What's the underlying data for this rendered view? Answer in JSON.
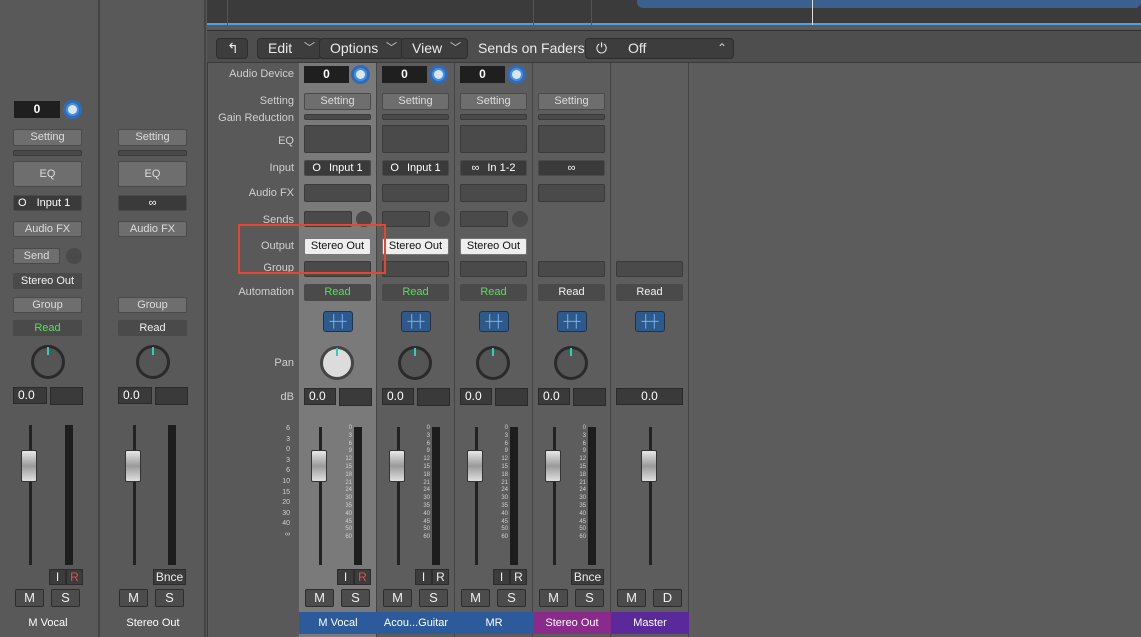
{
  "toolbar": {
    "back_icon": "↰",
    "edit": "Edit",
    "options": "Options",
    "view": "View",
    "sends_on_faders_label": "Sends on Faders:",
    "power_icon": "⏻",
    "sends_value": "Off",
    "updown_icon": "⌃"
  },
  "row_labels": {
    "audio_device": "Audio Device",
    "setting": "Setting",
    "gain_reduction": "Gain Reduction",
    "eq": "EQ",
    "input": "Input",
    "audio_fx": "Audio FX",
    "sends": "Sends",
    "output": "Output",
    "group": "Group",
    "automation": "Automation",
    "pan": "Pan",
    "db": "dB"
  },
  "inspector": {
    "left": {
      "audio_device": "0",
      "setting": "Setting",
      "eq": "EQ",
      "input": "Input 1",
      "audio_fx": "Audio FX",
      "send": "Send",
      "output": "Stereo Out",
      "group": "Group",
      "automation": "Read",
      "db": "0.0",
      "i": "I",
      "r": "R",
      "m": "M",
      "s": "S",
      "name": "M Vocal"
    },
    "right": {
      "setting": "Setting",
      "eq": "EQ",
      "input_icon": "∞",
      "audio_fx": "Audio FX",
      "group": "Group",
      "automation": "Read",
      "db": "0.0",
      "bnce": "Bnce",
      "m": "M",
      "s": "S",
      "name": "Stereo Out"
    }
  },
  "strips": [
    {
      "name": "M Vocal",
      "device": "0",
      "setting": "Setting",
      "input": "Input 1",
      "output": "Stereo Out",
      "automation": "Read",
      "db": "0.0",
      "i": "I",
      "r": "R",
      "m": "M",
      "s": "S",
      "color": "#2d5a9a"
    },
    {
      "name": "Acou...Guitar",
      "device": "0",
      "setting": "Setting",
      "input": "Input 1",
      "output": "Stereo Out",
      "automation": "Read",
      "db": "0.0",
      "i": "I",
      "r": "R",
      "m": "M",
      "s": "S",
      "color": "#2d5a9a"
    },
    {
      "name": "MR",
      "device": "0",
      "setting": "Setting",
      "input": "In 1-2",
      "output": "Stereo Out",
      "automation": "Read",
      "db": "0.0",
      "i": "I",
      "r": "R",
      "m": "M",
      "s": "S",
      "color": "#2d5a9a"
    },
    {
      "name": "Stereo Out",
      "setting": "Setting",
      "input": "∞",
      "automation": "Read",
      "db": "0.0",
      "bnce": "Bnce",
      "m": "M",
      "s": "S",
      "color": "#8a2a8a"
    },
    {
      "name": "Master",
      "automation": "Read",
      "db": "0.0",
      "m": "M",
      "d": "D",
      "color": "#5a2a9a"
    }
  ],
  "fader_scale": [
    "6",
    "3",
    "0",
    "3",
    "6",
    "10",
    "15",
    "20",
    "30",
    "40",
    "∞"
  ],
  "meter_scale": [
    "0",
    "3",
    "6",
    "9",
    "12",
    "15",
    "18",
    "21",
    "24",
    "30",
    "35",
    "40",
    "45",
    "50",
    "60"
  ],
  "wave_icon": "┼┼",
  "input_mono_icon": "O",
  "input_stereo_icon": "∞"
}
